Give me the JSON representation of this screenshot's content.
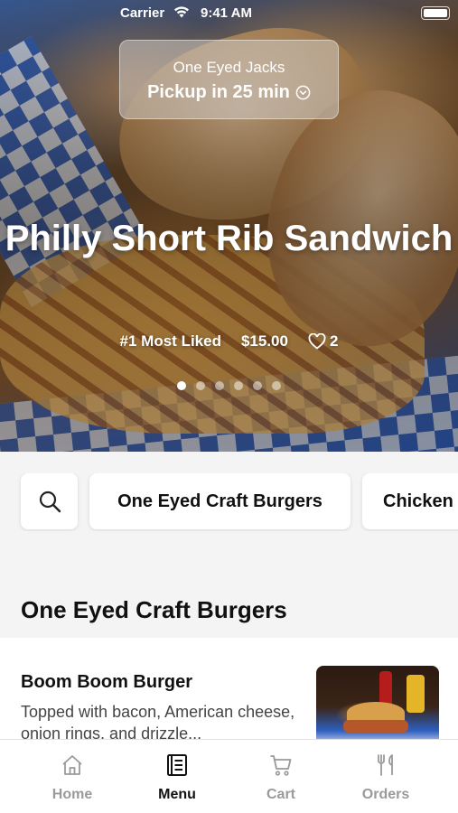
{
  "status_bar": {
    "carrier": "Carrier",
    "time": "9:41 AM"
  },
  "pickup": {
    "store_name": "One Eyed Jacks",
    "eta": "Pickup in 25 min"
  },
  "featured": {
    "title": "Philly Short Rib Sandwich",
    "tag": "#1 Most Liked",
    "price": "$15.00",
    "likes": "2",
    "slide_count": 6,
    "active_slide": 1
  },
  "categories": {
    "items": [
      "One Eyed Craft Burgers",
      "Chicken"
    ],
    "search_icon": "search-icon"
  },
  "section": {
    "title": "One Eyed Craft Burgers"
  },
  "menu_item": {
    "name": "Boom Boom Burger",
    "description": "Topped with bacon, American cheese, onion rings, and drizzle..."
  },
  "tabbar": {
    "tabs": [
      {
        "label": "Home",
        "icon": "home-icon",
        "active": false
      },
      {
        "label": "Menu",
        "icon": "menu-book-icon",
        "active": true
      },
      {
        "label": "Cart",
        "icon": "cart-icon",
        "active": false
      },
      {
        "label": "Orders",
        "icon": "utensils-icon",
        "active": false
      }
    ]
  },
  "colors": {
    "accent": "#111111",
    "inactive": "#9a9a9a",
    "checker_blue": "#2f5fbf"
  }
}
